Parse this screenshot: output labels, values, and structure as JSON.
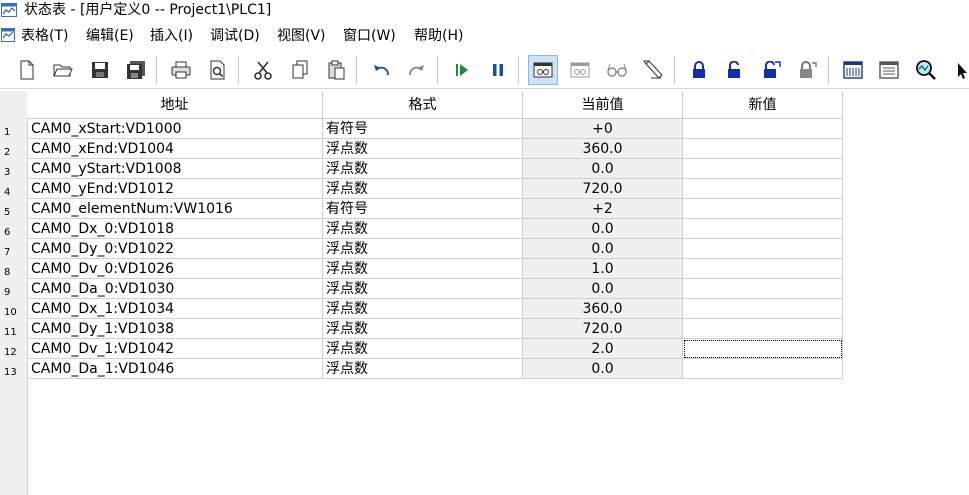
{
  "window": {
    "title": "状态表 - [用户定义0 -- Project1\\PLC1]"
  },
  "menu": [
    {
      "label": "表格(T)"
    },
    {
      "label": "编辑(E)"
    },
    {
      "label": "插入(I)"
    },
    {
      "label": "调试(D)"
    },
    {
      "label": "视图(V)"
    },
    {
      "label": "窗口(W)"
    },
    {
      "label": "帮助(H)"
    }
  ],
  "toolbar": {
    "icons": [
      "new-file-icon",
      "open-folder-icon",
      "save-icon",
      "save-all-icon",
      "print-icon",
      "print-preview-icon",
      "cut-icon",
      "copy-icon",
      "paste-icon",
      "undo-icon",
      "redo-icon",
      "run-icon",
      "pause-icon",
      "monitor-icon",
      "monitor-single-icon",
      "glasses-icon",
      "pen-icon",
      "lock-icon",
      "unlock-icon",
      "unlock-all-icon",
      "read-forced-icon",
      "trend-chart-icon",
      "table-view-icon",
      "zoom-icon",
      "cursor-icon"
    ]
  },
  "table": {
    "columns": [
      "地址",
      "格式",
      "当前值",
      "新值"
    ],
    "rows": [
      {
        "num": "1",
        "address": "CAM0_xStart:VD1000",
        "format": "有符号",
        "current": "+0",
        "new": ""
      },
      {
        "num": "2",
        "address": "CAM0_xEnd:VD1004",
        "format": "浮点数",
        "current": "360.0",
        "new": ""
      },
      {
        "num": "3",
        "address": "CAM0_yStart:VD1008",
        "format": "浮点数",
        "current": "0.0",
        "new": ""
      },
      {
        "num": "4",
        "address": "CAM0_yEnd:VD1012",
        "format": "浮点数",
        "current": "720.0",
        "new": ""
      },
      {
        "num": "5",
        "address": "CAM0_elementNum:VW1016",
        "format": "有符号",
        "current": "+2",
        "new": ""
      },
      {
        "num": "6",
        "address": "CAM0_Dx_0:VD1018",
        "format": "浮点数",
        "current": "0.0",
        "new": ""
      },
      {
        "num": "7",
        "address": "CAM0_Dy_0:VD1022",
        "format": "浮点数",
        "current": "0.0",
        "new": ""
      },
      {
        "num": "8",
        "address": "CAM0_Dv_0:VD1026",
        "format": "浮点数",
        "current": "1.0",
        "new": ""
      },
      {
        "num": "9",
        "address": "CAM0_Da_0:VD1030",
        "format": "浮点数",
        "current": "0.0",
        "new": ""
      },
      {
        "num": "10",
        "address": "CAM0_Dx_1:VD1034",
        "format": "浮点数",
        "current": "360.0",
        "new": ""
      },
      {
        "num": "11",
        "address": "CAM0_Dy_1:VD1038",
        "format": "浮点数",
        "current": "720.0",
        "new": ""
      },
      {
        "num": "12",
        "address": "CAM0_Dv_1:VD1042",
        "format": "浮点数",
        "current": "2.0",
        "new": ""
      },
      {
        "num": "13",
        "address": "CAM0_Da_1:VD1046",
        "format": "浮点数",
        "current": "0.0",
        "new": ""
      }
    ]
  }
}
